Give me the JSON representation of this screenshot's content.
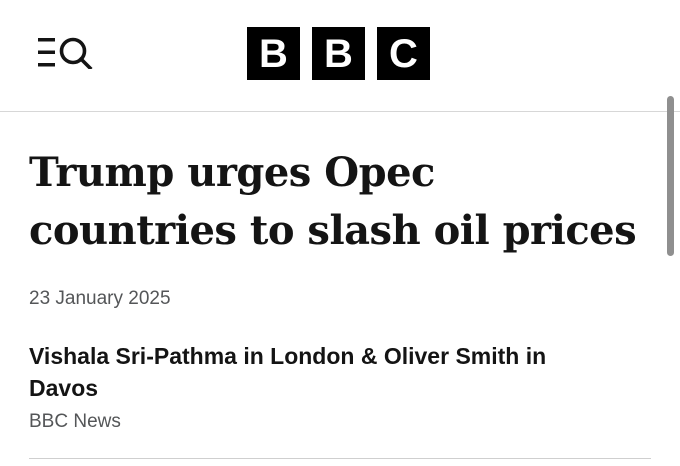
{
  "header": {
    "menu_icon": "menu-icon",
    "search_icon": "search-icon",
    "logo_letters": [
      "B",
      "B",
      "C"
    ]
  },
  "article": {
    "headline_line1": "Trump urges Opec",
    "headline_line2": "countries to slash oil prices",
    "date": "23 January 2025",
    "byline_line1": "Vishala Sri-Pathma in London & Oliver Smith in",
    "byline_line2": "Davos",
    "source": "BBC News"
  },
  "colors": {
    "text": "#141414",
    "muted": "#545658",
    "logo_bg": "#000000",
    "logo_fg": "#ffffff"
  }
}
